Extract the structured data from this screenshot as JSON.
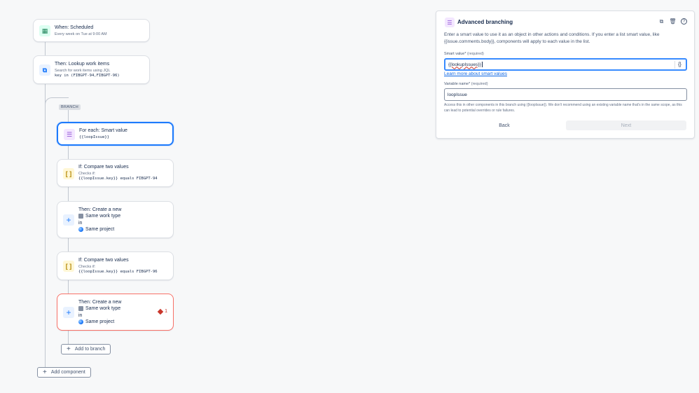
{
  "flow": {
    "trigger": {
      "title": "When: Scheduled",
      "subtitle": "Every week on Tue at 9:00 AM"
    },
    "lookup": {
      "title": "Then: Lookup work items",
      "subtitle": "Search for work items using JQL",
      "jql": "key in (FIBGPT-94,FIBGPT-96)"
    },
    "branch_label": "BRANCH",
    "foreach": {
      "title": "For each: Smart value",
      "value": "{{loopIssue}}"
    },
    "if1": {
      "title": "If: Compare two values",
      "checks": "Checks if:",
      "condition": "{{loopIssue.key}} equals FIBGPT-94"
    },
    "create1": {
      "title": "Then: Create a new",
      "type": "Same work type",
      "in": "in",
      "project": "Same project"
    },
    "if2": {
      "title": "If: Compare two values",
      "checks": "Checks if:",
      "condition": "{{loopIssue.key}} equals FIBGPT-96"
    },
    "create2": {
      "title": "Then: Create a new",
      "type": "Same work type",
      "in": "in",
      "project": "Same project",
      "error_count": "1"
    },
    "add_to_branch": "Add to branch",
    "add_component": "Add component"
  },
  "panel": {
    "title": "Advanced branching",
    "description": "Enter a smart value to use it as an object in other actions and conditions. If you enter a list smart value, like {{issue.comments.body}}, components will apply to each value in the list.",
    "smart_value_label": "Smart value",
    "smart_value_required": "(required)",
    "smart_value": "{{lookupIssues}}",
    "learn_more": "Learn more about smart values",
    "variable_label": "Variable name",
    "variable_required": "(required)",
    "variable_value": "loopIssue",
    "help": "Access this in other components in this branch using {{loopIssue}}. We don't recommend using an existing variable name that's in the same scope, as this can lead to potential overrides or rule failures.",
    "back": "Back",
    "next": "Next"
  }
}
